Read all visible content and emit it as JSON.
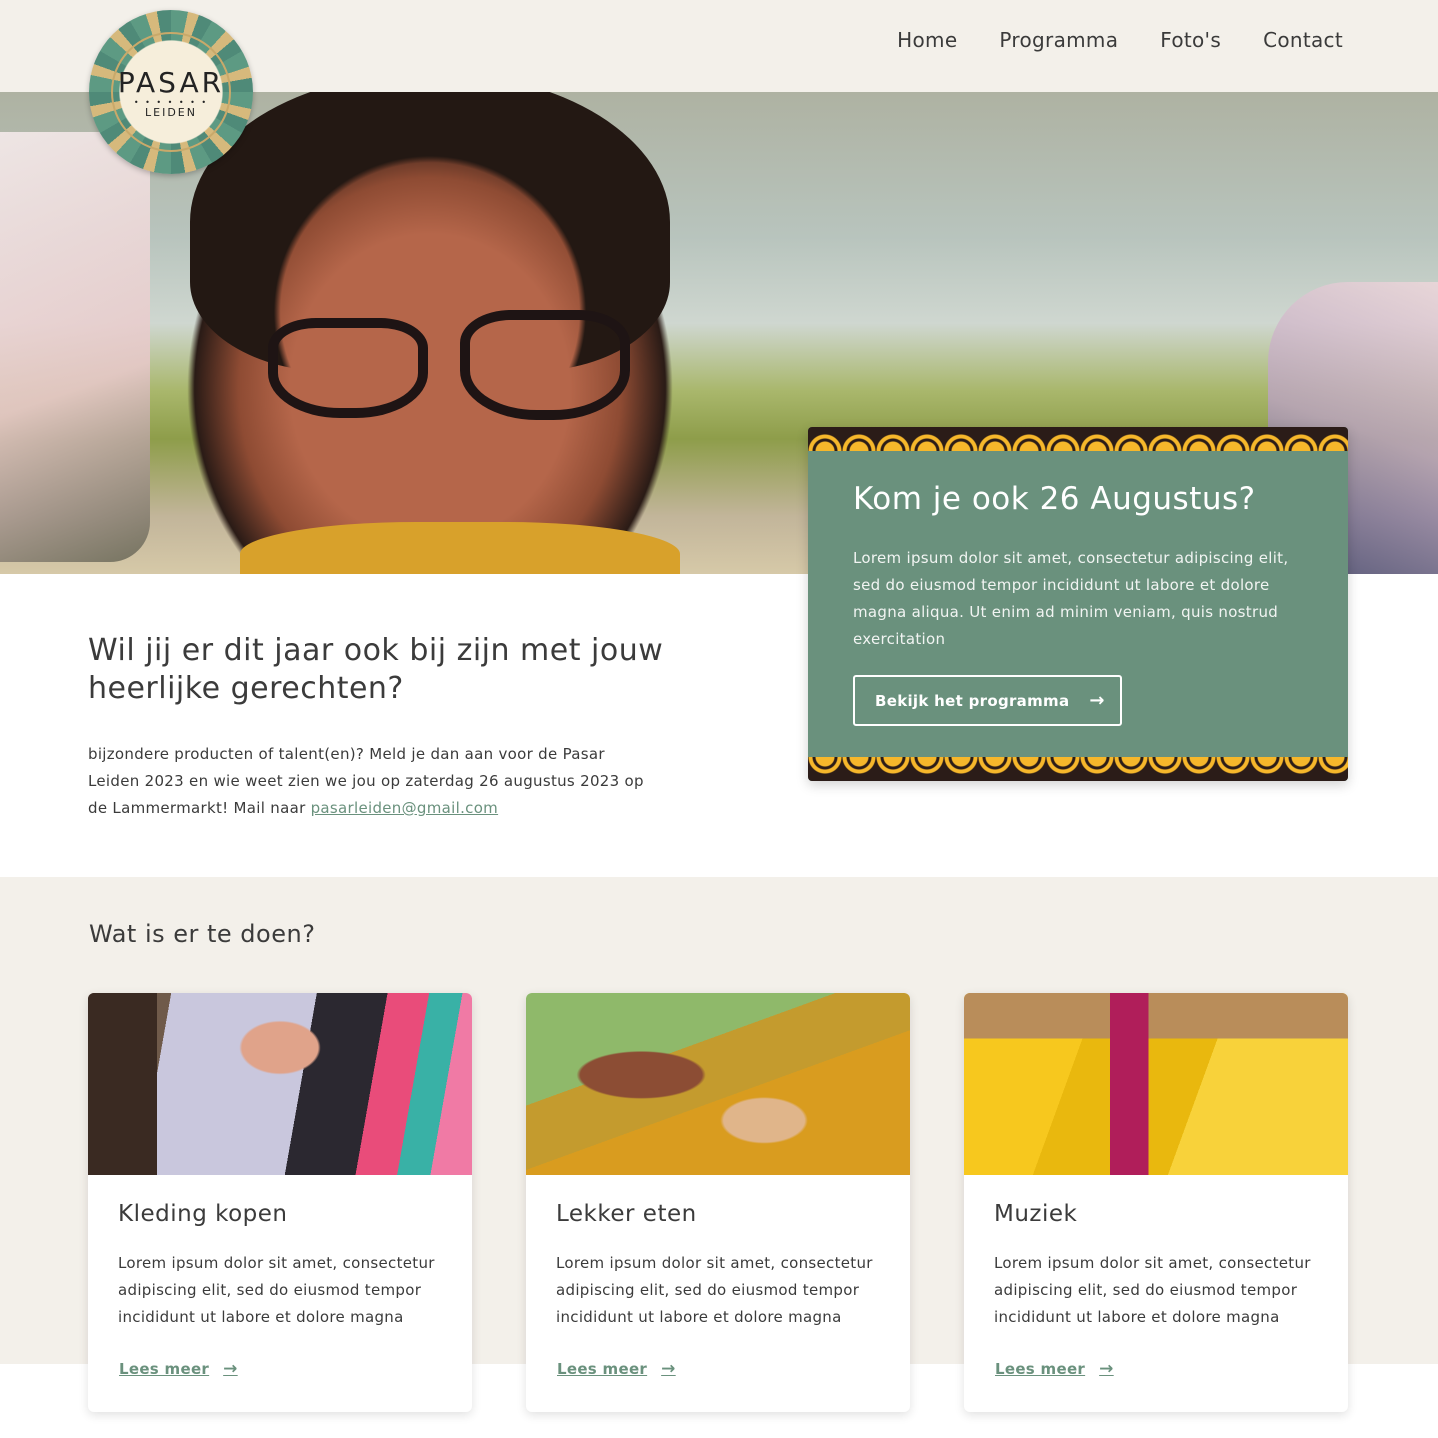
{
  "header": {
    "logo": {
      "title": "PASAR",
      "subtitle": "LEIDEN"
    },
    "nav": [
      "Home",
      "Programma",
      "Foto's",
      "Contact"
    ]
  },
  "event": {
    "title": "Kom je ook 26 Augustus?",
    "text": "Lorem ipsum dolor sit amet, consectetur adipiscing elit, sed do eiusmod tempor incididunt ut labore et dolore magna aliqua. Ut enim ad minim veniam, quis nostrud exercitation",
    "button_label": "Bekijk het programma"
  },
  "intro": {
    "title": "Wil jij er dit jaar ook bij zijn met jouw heerlijke gerechten?",
    "text": "bijzondere producten of talent(en)? Meld je dan aan voor de Pasar Leiden 2023 en wie weet zien we jou op zaterdag 26 augustus 2023 op de Lammermarkt! Mail naar ",
    "email": "pasarleiden@gmail.com"
  },
  "activities": {
    "title": "Wat is er te doen?",
    "cards": [
      {
        "title": "Kleding kopen",
        "text": "Lorem ipsum dolor sit amet, consectetur adipiscing elit, sed do eiusmod tempor incididunt ut labore et dolore magna",
        "link": "Lees meer"
      },
      {
        "title": "Lekker eten",
        "text": "Lorem ipsum dolor sit amet, consectetur adipiscing elit, sed do eiusmod tempor incididunt ut labore et dolore magna",
        "link": "Lees meer"
      },
      {
        "title": "Muziek",
        "text": "Lorem ipsum dolor sit amet, consectetur adipiscing elit, sed do eiusmod tempor incididunt ut labore et dolore magna",
        "link": "Lees meer"
      }
    ]
  },
  "colors": {
    "accent": "#6a917d",
    "header_bg": "#f3f0ea",
    "text": "#3b3b3b",
    "pattern": "#f6b72b"
  },
  "icons": {
    "arrow": "arrow-right-icon"
  }
}
